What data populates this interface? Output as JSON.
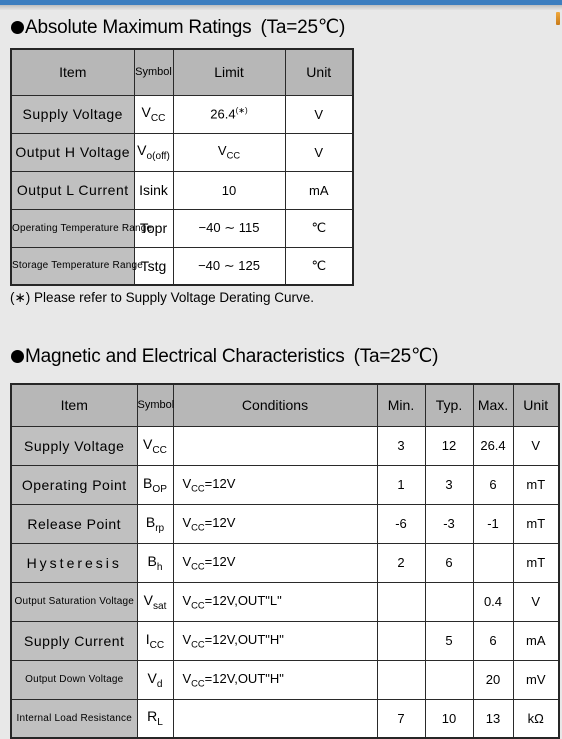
{
  "document": {
    "sections": [
      {
        "id": "absolute-maximum-ratings",
        "bullet": "●",
        "title": "Absolute Maximum Ratings",
        "condition": "(Ta=25℃)",
        "footnote": "(∗) Please refer to Supply Voltage Derating Curve."
      },
      {
        "id": "magnetic-electrical-characteristics",
        "bullet": "●",
        "title": "Magnetic and Electrical Characteristics",
        "condition": "(Ta=25℃)"
      }
    ]
  },
  "table_amr": {
    "headers": [
      "Item",
      "Symbol",
      "Limit",
      "Unit"
    ],
    "rows": [
      {
        "item": "Supply  Voltage",
        "symbol_base": "V",
        "symbol_sub": "CC",
        "limit": "26.4",
        "limit_sup": "(∗)",
        "unit": "V"
      },
      {
        "item": "Output H Voltage",
        "symbol_base": "V",
        "symbol_sub": "o(off)",
        "limit_base": "V",
        "limit_sub": "CC",
        "unit": "V"
      },
      {
        "item": "Output  L  Current",
        "symbol_base": "Isink",
        "symbol_sub": "",
        "limit": "10",
        "unit": "mA"
      },
      {
        "item": "Operating  Temperature  Range",
        "symbol_base": "Topr",
        "symbol_sub": "",
        "limit": "−40 ∼ 115",
        "unit": "℃"
      },
      {
        "item": "Storage Temperature Range",
        "symbol_base": "Tstg",
        "symbol_sub": "",
        "limit": "−40 ∼ 125",
        "unit": "℃"
      }
    ]
  },
  "table_mec": {
    "headers": [
      "Item",
      "Symbol",
      "Conditions",
      "Min.",
      "Typ.",
      "Max.",
      "Unit"
    ],
    "rows": [
      {
        "item": "Supply  Voltage",
        "symbol_base": "V",
        "symbol_sub": "CC",
        "cond_base": "",
        "cond_sub": "",
        "cond_tail": "",
        "min": "3",
        "typ": "12",
        "max": "26.4",
        "unit": "V"
      },
      {
        "item": "Operating Point",
        "symbol_base": "B",
        "symbol_sub": "OP",
        "cond_base": "V",
        "cond_sub": "CC",
        "cond_tail": "=12V",
        "min": "1",
        "typ": "3",
        "max": "6",
        "unit": "mT"
      },
      {
        "item": "Release  Point",
        "symbol_base": "B",
        "symbol_sub": "rp",
        "cond_base": "V",
        "cond_sub": "CC",
        "cond_tail": "=12V",
        "min": "-6",
        "typ": "-3",
        "max": "-1",
        "unit": "mT"
      },
      {
        "item": "Hysteresis",
        "symbol_base": "B",
        "symbol_sub": "h",
        "cond_base": "V",
        "cond_sub": "CC",
        "cond_tail": "=12V",
        "min": "2",
        "typ": "6",
        "max": "",
        "unit": "mT"
      },
      {
        "item": "Output Saturation Voltage",
        "symbol_base": "V",
        "symbol_sub": "sat",
        "cond_base": "V",
        "cond_sub": "CC",
        "cond_tail": "=12V,OUT\"L\"",
        "min": "",
        "typ": "",
        "max": "0.4",
        "unit": "V"
      },
      {
        "item": "Supply  Current",
        "symbol_base": "I",
        "symbol_sub": "CC",
        "cond_base": "V",
        "cond_sub": "CC",
        "cond_tail": "=12V,OUT\"H\"",
        "min": "",
        "typ": "5",
        "max": "6",
        "unit": "mA"
      },
      {
        "item": "Output  Down  Voltage",
        "symbol_base": "V",
        "symbol_sub": "d",
        "cond_base": "V",
        "cond_sub": "CC",
        "cond_tail": "=12V,OUT\"H\"",
        "min": "",
        "typ": "",
        "max": "20",
        "unit": "mV"
      },
      {
        "item": "Internal  Load  Resistance",
        "symbol_base": "R",
        "symbol_sub": "L",
        "cond_base": "",
        "cond_sub": "",
        "cond_tail": "",
        "min": "7",
        "typ": "10",
        "max": "13",
        "unit": "kΩ"
      }
    ]
  },
  "style": {
    "header_fill": "#b7b7b7",
    "item_fill": "#c0c0c0",
    "page_background": "#e8e8e8",
    "top_bar_color": "#3d7ebf",
    "border_color": "#2a2a2a"
  }
}
